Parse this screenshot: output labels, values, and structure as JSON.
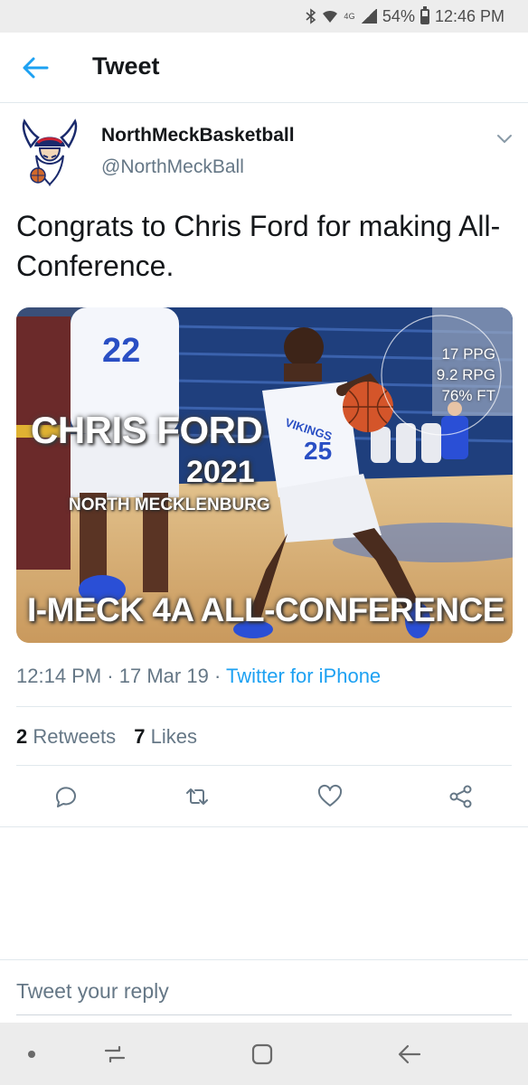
{
  "status_bar": {
    "network": "4G",
    "battery": "54%",
    "time": "12:46 PM"
  },
  "header": {
    "title": "Tweet"
  },
  "tweet": {
    "author_name": "NorthMeckBasketball",
    "author_handle": "@NorthMeckBall",
    "text": "Congrats to Chris Ford for making All-Conference.",
    "media": {
      "name": "CHRIS FORD",
      "year": "2021",
      "school": "NORTH MECKLENBURG",
      "conference": "I-MECK 4A ALL-CONFERENCE",
      "stats": [
        "17 PPG",
        "9.2 RPG",
        "76% FT"
      ],
      "jersey_left": "22",
      "jersey_right": "25",
      "jersey_team": "VIKINGS"
    },
    "time": "12:14 PM",
    "date": "17 Mar 19",
    "separator": "·",
    "source": "Twitter for iPhone",
    "retweets_count": "2",
    "retweets_label": "Retweets",
    "likes_count": "7",
    "likes_label": "Likes"
  },
  "reply": {
    "placeholder": "Tweet your reply"
  },
  "colors": {
    "accent": "#1da1f2",
    "secondary_text": "#657786",
    "primary_text": "#14171a",
    "divider": "#e1e8ed"
  },
  "icons": {
    "back": "arrow-left-icon",
    "caret": "chevron-down-icon",
    "reply": "comment-bubble-icon",
    "retweet": "retweet-icon",
    "like": "heart-icon",
    "share": "share-icon",
    "nav_dot": "dot-icon",
    "nav_recents": "recents-icon",
    "nav_home": "home-icon",
    "nav_back": "back-icon"
  }
}
